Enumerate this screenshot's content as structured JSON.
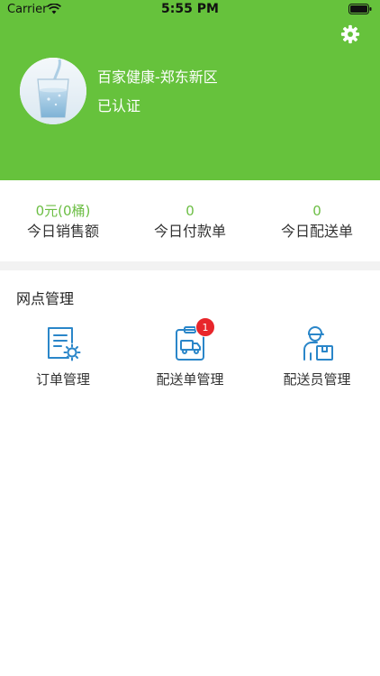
{
  "status_bar": {
    "carrier": "Carrier",
    "time": "5:55 PM"
  },
  "profile": {
    "store_name": "百家健康-郑东新区",
    "verify_status": "已认证"
  },
  "stats": [
    {
      "value": "0元(0桶)",
      "label": "今日销售额"
    },
    {
      "value": "0",
      "label": "今日付款单"
    },
    {
      "value": "0",
      "label": "今日配送单"
    }
  ],
  "section": {
    "title": "网点管理"
  },
  "tiles": [
    {
      "label": "订单管理",
      "icon": "order-doc-icon"
    },
    {
      "label": "配送单管理",
      "icon": "delivery-clipboard-icon",
      "badge": "1"
    },
    {
      "label": "配送员管理",
      "icon": "courier-icon"
    }
  ],
  "colors": {
    "header": "#66c23c",
    "accent": "#6cbe44",
    "icon_blue": "#2a86c9",
    "badge": "#e8262b"
  }
}
